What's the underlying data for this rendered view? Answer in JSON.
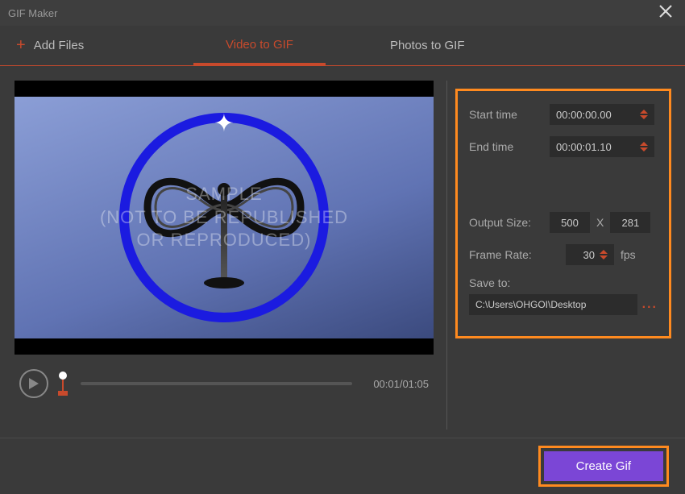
{
  "title": "GIF Maker",
  "toolbar": {
    "add_files": "Add Files",
    "video_to_gif": "Video to GIF",
    "photos_to_gif": "Photos to GIF"
  },
  "preview": {
    "watermark_line1": "SAMPLE",
    "watermark_line2": "(NOT TO BE REPUBLISHED",
    "watermark_line3": "OR REPRODUCED)"
  },
  "transport": {
    "time_display": "00:01/01:05"
  },
  "settings": {
    "start_time_label": "Start time",
    "start_time_value": "00:00:00.00",
    "end_time_label": "End time",
    "end_time_value": "00:00:01.10",
    "output_size_label": "Output Size:",
    "output_w": "500",
    "output_x": "X",
    "output_h": "281",
    "frame_rate_label": "Frame Rate:",
    "frame_rate_value": "30",
    "fps_suffix": "fps",
    "save_to_label": "Save to:",
    "save_to_path": "C:\\Users\\OHGOI\\Desktop",
    "browse_ellipsis": "..."
  },
  "footer": {
    "create_label": "Create Gif"
  }
}
